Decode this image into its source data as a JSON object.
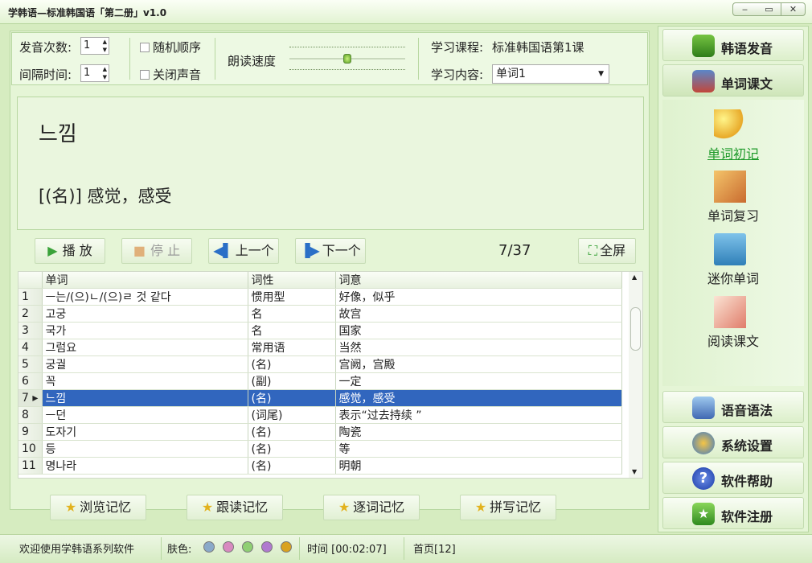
{
  "window": {
    "title": "学韩语—标准韩国语「第二册」v1.0",
    "min_glyph": "‒",
    "max_glyph": "▭",
    "close_glyph": "✕"
  },
  "controls": {
    "repeat_label": "发音次数:",
    "repeat_value": "1",
    "interval_label": "间隔时间:",
    "interval_value": "1",
    "random_label": "随机顺序",
    "mute_label": "关闭声音",
    "speed_label": "朗读速度",
    "speed_level": 0.5,
    "course_label": "学习课程:",
    "course_value": "标准韩国语第1课",
    "content_label": "学习内容:",
    "content_value": "单词1"
  },
  "display": {
    "word": "느낌",
    "meaning": "[(名)] 感觉，感受"
  },
  "toolbar": {
    "play": "播 放",
    "stop": "停 止",
    "prev": "上一个",
    "next": "下一个",
    "counter": "7/37",
    "fullscreen": "全屏"
  },
  "table": {
    "headers": [
      "",
      "单词",
      "词性",
      "词意"
    ],
    "rows": [
      [
        "1",
        "ㅡ는/(으)ㄴ/(으)ㄹ 것 같다",
        "惯用型",
        "好像，似乎"
      ],
      [
        "2",
        "고궁",
        "名",
        "故宫"
      ],
      [
        "3",
        "국가",
        "名",
        "国家"
      ],
      [
        "4",
        "그럼요",
        "常用语",
        "当然"
      ],
      [
        "5",
        "궁궐",
        "(名)",
        "宫阙，宫殿"
      ],
      [
        "6",
        "꼭",
        "(副)",
        "一定"
      ],
      [
        "7 ▸",
        "느낌",
        "(名)",
        "感觉，感受"
      ],
      [
        "8",
        "ㅡ던",
        "(词尾)",
        "表示“过去持续 ”"
      ],
      [
        "9",
        "도자기",
        "(名)",
        "陶瓷"
      ],
      [
        "10",
        "등",
        "(名)",
        "等"
      ],
      [
        "11",
        "명나라",
        "(名)",
        "明朝"
      ]
    ],
    "selected_index": 6
  },
  "memory_buttons": [
    "浏览记忆",
    "跟读记忆",
    "逐词记忆",
    "拼写记忆"
  ],
  "sidebar": {
    "pronunciation": "韩语发音",
    "vocab_text": "单词课文",
    "sub_items": [
      "单词初记",
      "单词复习",
      "迷你单词",
      "阅读课文"
    ],
    "grammar": "语音语法",
    "settings": "系统设置",
    "help": "软件帮助",
    "register": "软件注册"
  },
  "status": {
    "welcome": "欢迎使用学韩语系列软件",
    "skin_label": "肤色:",
    "skin_colors": [
      "#8aa9c9",
      "#d889c0",
      "#8fcf74",
      "#b079cf",
      "#d9a220"
    ],
    "time": "时间 [00:02:07]",
    "page": "首页[12]"
  },
  "colors": {
    "accent": "#3166be",
    "background": "#d6ecc0"
  }
}
